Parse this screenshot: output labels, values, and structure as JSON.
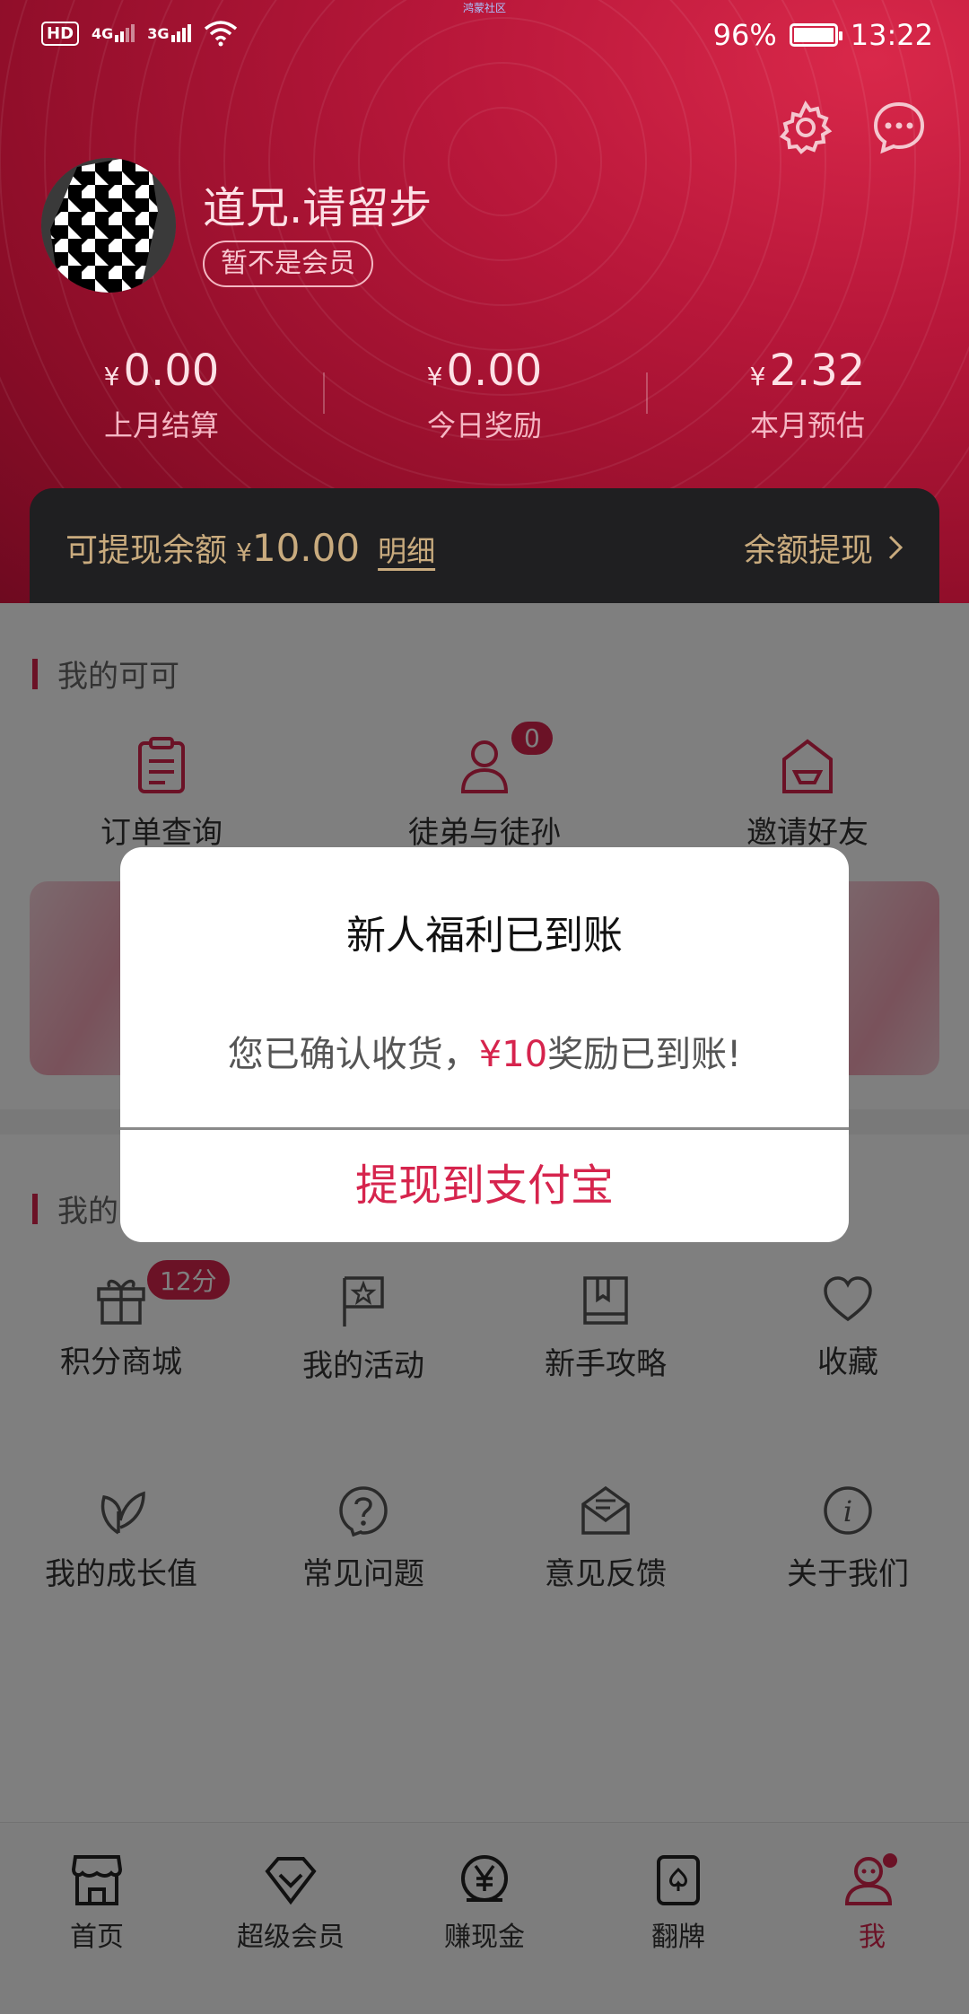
{
  "status_bar": {
    "hd": "HD",
    "net1": "4G",
    "net2": "3G",
    "center_text": "鸿蒙社区",
    "battery": "96%",
    "time": "13:22"
  },
  "profile": {
    "username": "道兄.请留步",
    "member_status": "暂不是会员"
  },
  "stats": [
    {
      "currency": "¥",
      "value": "0.00",
      "label": "上月结算"
    },
    {
      "currency": "¥",
      "value": "0.00",
      "label": "今日奖励"
    },
    {
      "currency": "¥",
      "value": "2.32",
      "label": "本月预估"
    }
  ],
  "balance": {
    "label": "可提现余额",
    "currency": "¥",
    "amount": "10.00",
    "detail": "明细",
    "withdraw": "余额提现"
  },
  "my_section": {
    "title": "我的可可",
    "items": [
      {
        "label": "订单查询",
        "icon": "clipboard-icon"
      },
      {
        "label": "徒弟与徒孙",
        "icon": "person-icon",
        "badge": "0"
      },
      {
        "label": "邀请好友",
        "icon": "envelope-icon"
      }
    ]
  },
  "tools_section": {
    "title": "我的",
    "row1": [
      {
        "label": "积分商城",
        "icon": "gift-icon",
        "badge": "12分"
      },
      {
        "label": "我的活动",
        "icon": "flag-icon"
      },
      {
        "label": "新手攻略",
        "icon": "book-icon"
      },
      {
        "label": "收藏",
        "icon": "heart-icon"
      }
    ],
    "row2": [
      {
        "label": "我的成长值",
        "icon": "leaf-icon"
      },
      {
        "label": "常见问题",
        "icon": "question-icon"
      },
      {
        "label": "意见反馈",
        "icon": "feedback-icon"
      },
      {
        "label": "关于我们",
        "icon": "info-icon"
      }
    ]
  },
  "tabbar": [
    {
      "label": "首页",
      "icon": "store-icon"
    },
    {
      "label": "超级会员",
      "icon": "diamond-icon"
    },
    {
      "label": "赚现金",
      "icon": "yuan-icon"
    },
    {
      "label": "翻牌",
      "icon": "card-icon"
    },
    {
      "label": "我",
      "icon": "profile-icon",
      "active": true
    }
  ],
  "dialog": {
    "title": "新人福利已到账",
    "message_prefix": "您已确认收货，",
    "message_amount": "¥10",
    "message_suffix": "奖励已到账!",
    "action": "提现到支付宝"
  },
  "colors": {
    "accent": "#d6244d",
    "header_dark": "#6e0a20",
    "balance_bg": "#1f1f21",
    "balance_text": "#c9ab7e"
  }
}
